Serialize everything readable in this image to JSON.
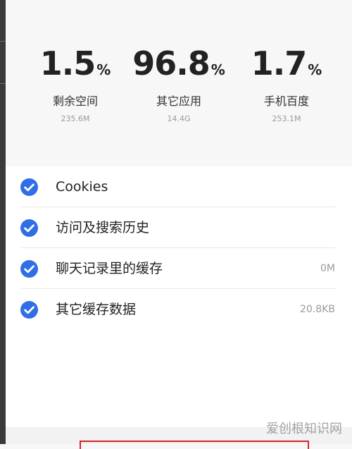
{
  "stats": [
    {
      "value": "1.5",
      "unit": "%",
      "label": "剩余空间",
      "size": "235.6M"
    },
    {
      "value": "96.8",
      "unit": "%",
      "label": "其它应用",
      "size": "14.4G"
    },
    {
      "value": "1.7",
      "unit": "%",
      "label": "手机百度",
      "size": "253.1M"
    }
  ],
  "items": [
    {
      "label": "Cookies",
      "size": "",
      "checked": true
    },
    {
      "label": "访问及搜索历史",
      "size": "",
      "checked": true
    },
    {
      "label": "聊天记录里的缓存",
      "size": "0M",
      "checked": true
    },
    {
      "label": "其它缓存数据",
      "size": "20.8KB",
      "checked": true
    }
  ],
  "watermark": "爱创根知识网",
  "colors": {
    "check": "#2f6ee5",
    "button_border": "#d9222a"
  },
  "icons": {
    "check": "check-circle-icon"
  }
}
